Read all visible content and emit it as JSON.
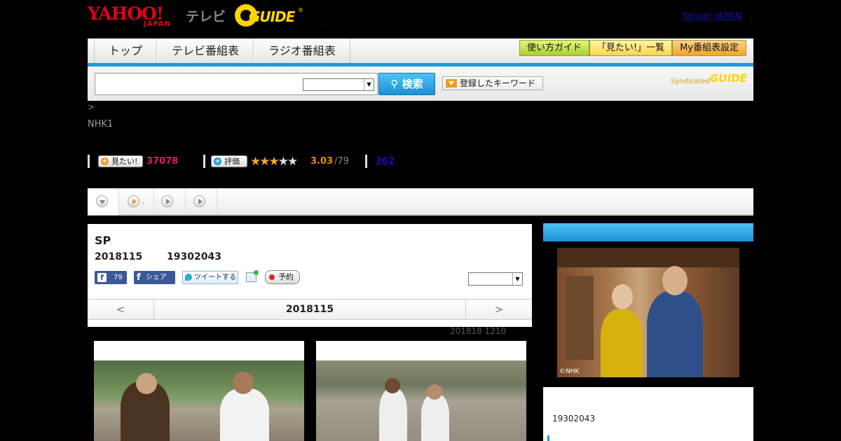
{
  "header": {
    "yahoo_logo": "YAHOO!",
    "japan_logo": "JAPAN",
    "tv_label": "テレビ",
    "gguide_logo": "GUIDE",
    "gguide_reg": "®",
    "yahoo_japan_link": "Yahoo! JAPAN",
    "dot_left": ",",
    "dot_right": ","
  },
  "nav": {
    "tabs": [
      "トップ",
      "テレビ番組表",
      "ラジオ番組表"
    ],
    "buttons": [
      "使い方ガイド",
      "「見たい!」一覧",
      "My番組表設定"
    ]
  },
  "search": {
    "input_value": "",
    "select_value": "",
    "button_label": "検索",
    "keyword_button": "登録したキーワード",
    "syndicated_label": "Syndicated",
    "syndicated_logo": "GUIDE"
  },
  "program": {
    "breadcrumb": ">",
    "channel": "NHK1",
    "mitai_label": "見たい!",
    "mitai_count": "37078",
    "rating_label": "評価",
    "stars_on": 3,
    "stars_off": 2,
    "rating_value": "3.03",
    "rating_count": "/79",
    "review_count": "362",
    "title": "SP",
    "date": "2018115",
    "time": "19302043",
    "fb_count": "79",
    "fb_share": "シェア",
    "tweet": "ツイートする",
    "reserve": "予約",
    "select_value": "",
    "pager_prev": "<",
    "pager_date": "2018115",
    "pager_next": ">",
    "updated": "201818  1210"
  },
  "tab_strip": {
    "tab2_dot": "."
  },
  "sidebar": {
    "image_credit": "©NHK",
    "time": "19302043"
  },
  "colors": {
    "accent_blue": "#1a9ad6",
    "mitai_pink": "#e4185c",
    "rating_orange": "#f08a00",
    "gguide_yellow": "#ffd400",
    "yahoo_red": "#e60012"
  },
  "icons": [
    "search-icon",
    "play-icon",
    "dropdown-icon",
    "facebook-icon",
    "twitter-icon",
    "calendar-add-icon",
    "record-icon",
    "star-icon"
  ]
}
